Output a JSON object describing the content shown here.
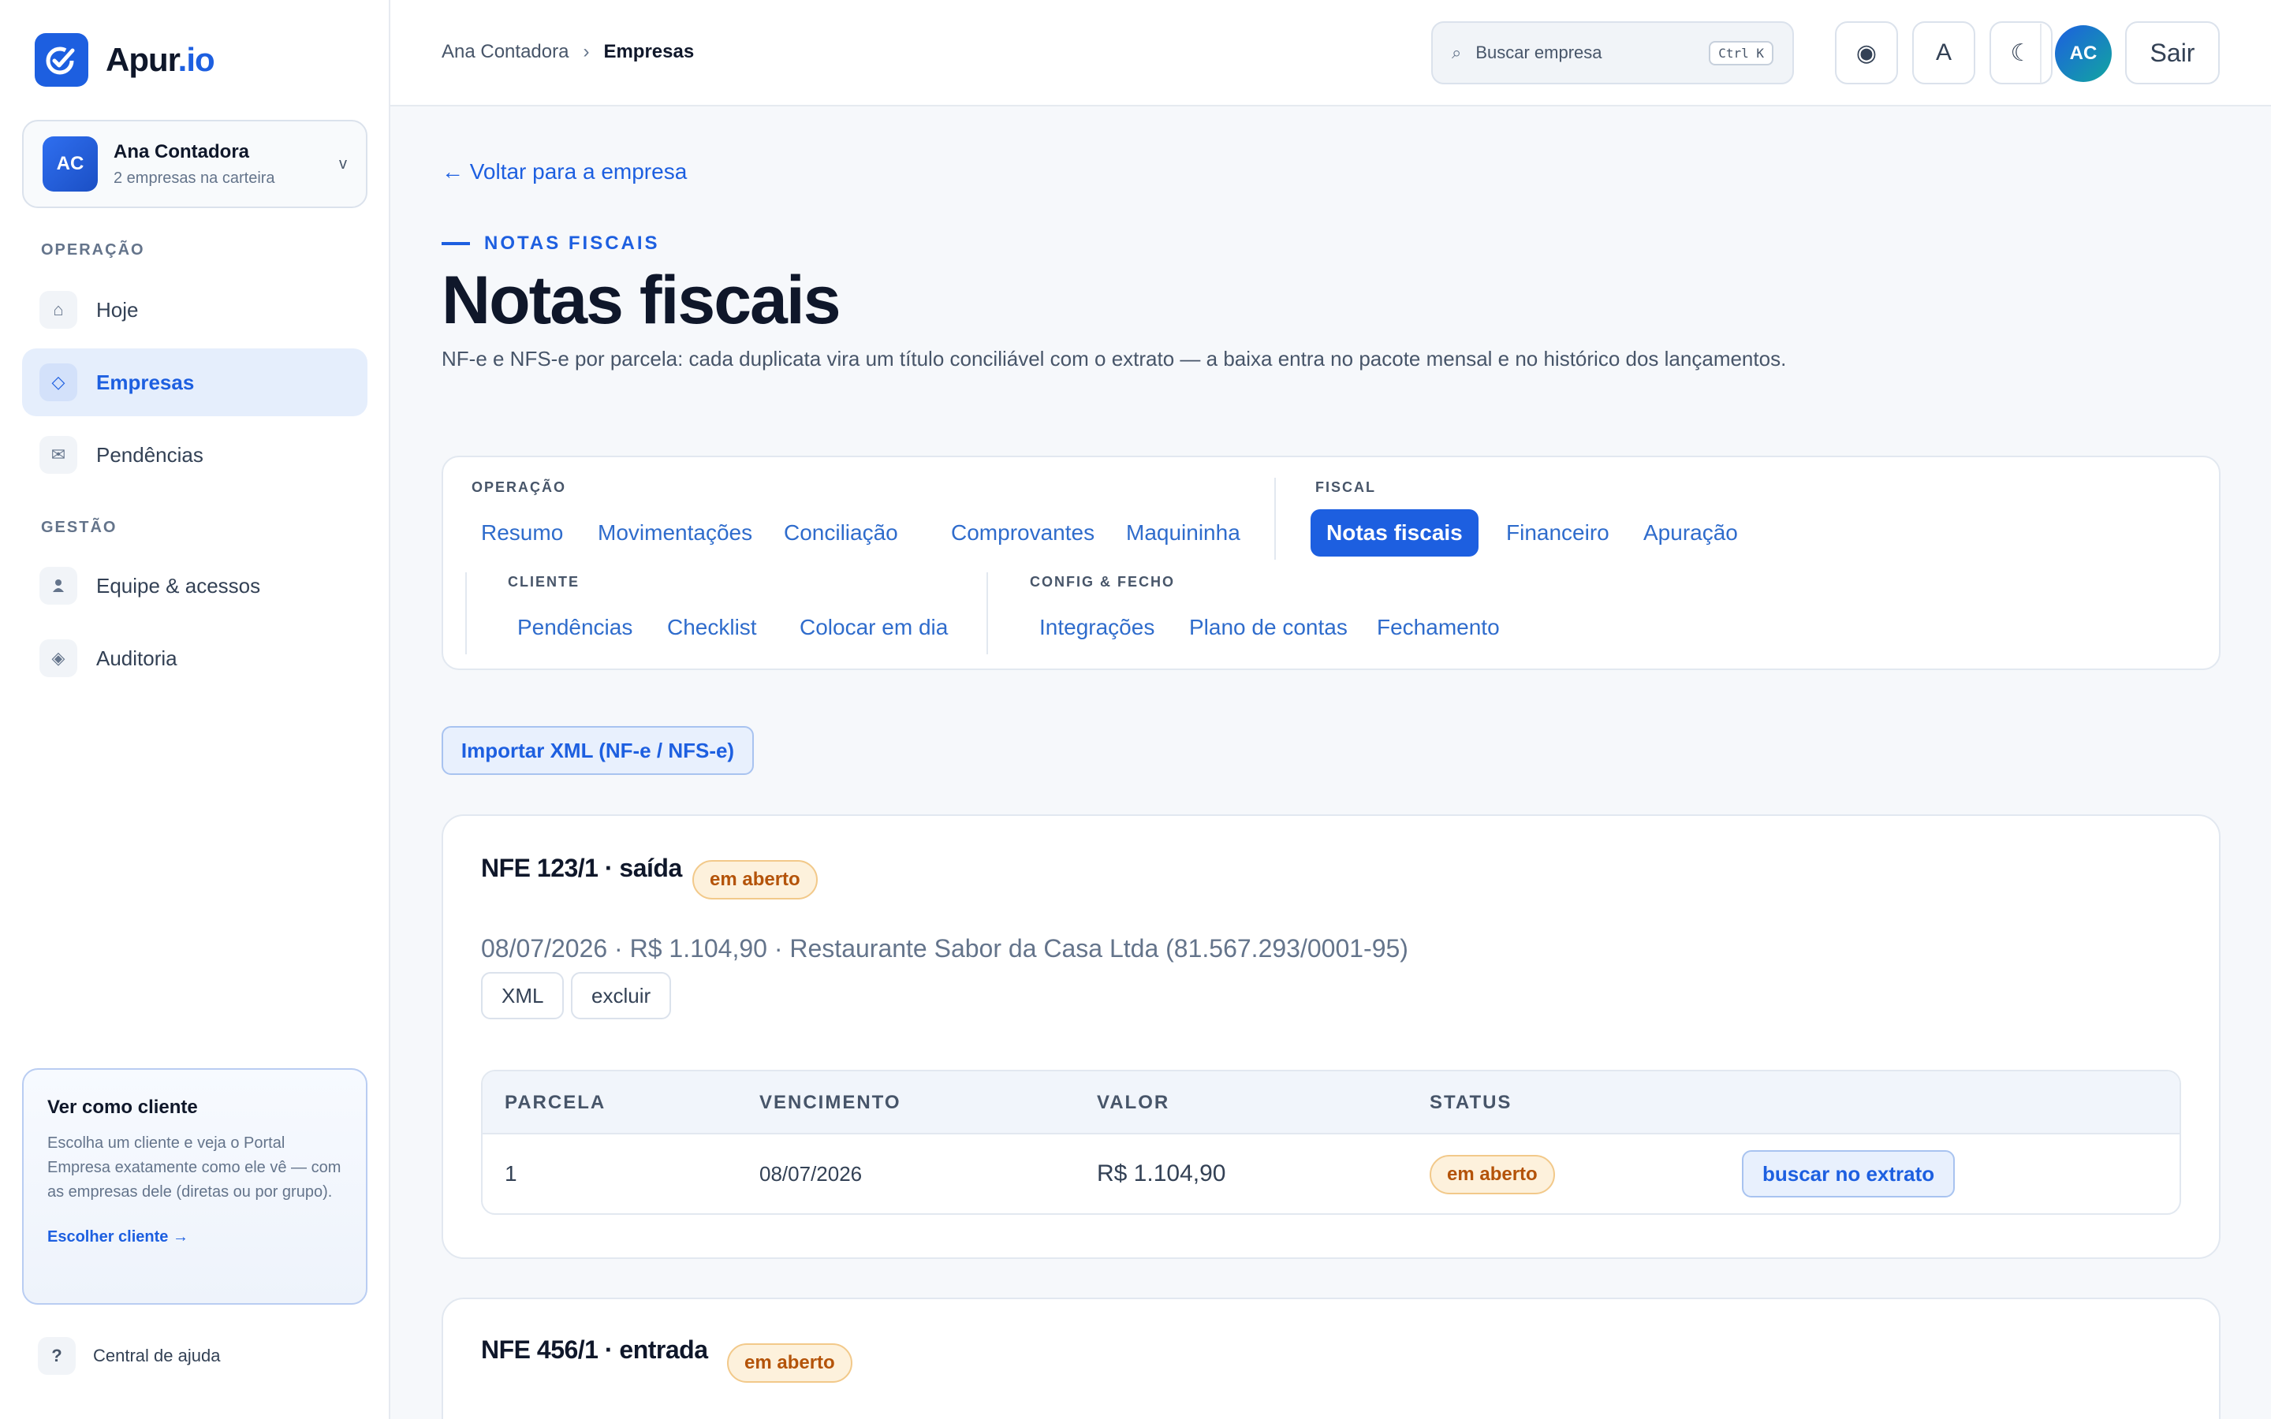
{
  "colors": {
    "accent": "#1d5fe0",
    "badge_open_bg": "#fdf1dc",
    "badge_open_text": "#b45309",
    "page_bg": "#f6f8fb"
  },
  "brand": {
    "name_prefix": "Apur",
    "name_suffix": ".io",
    "icon": "check-circle-icon"
  },
  "account": {
    "initials": "AC",
    "name": "Ana Contadora",
    "subtitle": "2 empresas na carteira",
    "chevron": "v"
  },
  "sidebar": {
    "sections": [
      {
        "label": "OPERAÇÃO"
      },
      {
        "label": "GESTÃO"
      }
    ],
    "items": [
      {
        "label": "Hoje",
        "icon": "home-icon",
        "glyph": "⌂"
      },
      {
        "label": "Empresas",
        "icon": "diamond-icon",
        "glyph": "◇"
      },
      {
        "label": "Pendências",
        "icon": "mail-icon",
        "glyph": "✉"
      },
      {
        "label": "Equipe & acessos",
        "icon": "user-icon",
        "glyph": "👤"
      },
      {
        "label": "Auditoria",
        "icon": "audit-icon",
        "glyph": "◈"
      }
    ]
  },
  "client_view": {
    "title": "Ver como cliente",
    "description": "Escolha um cliente e veja o Portal Empresa exatamente como ele vê — com as empresas dele (diretas ou por grupo).",
    "link": "Escolher cliente →"
  },
  "help": {
    "label": "Central de ajuda",
    "glyph": "?"
  },
  "topbar": {
    "breadcrumb": [
      "Ana Contadora",
      "Empresas"
    ],
    "breadcrumb_sep": "›",
    "search": {
      "placeholder": "Buscar empresa",
      "shortcut": "Ctrl K",
      "glyph": "⌕"
    },
    "buttons": [
      {
        "icon": "record-icon",
        "glyph": "◉"
      },
      {
        "icon": "font-size-icon",
        "glyph": "A"
      },
      {
        "icon": "moon-icon",
        "glyph": "☾"
      }
    ],
    "avatar_initials": "AC",
    "logout_label": "Sair"
  },
  "main": {
    "back_link": "← Voltar para a empresa",
    "eyebrow": "NOTAS FISCAIS",
    "title": "Notas fiscais",
    "description": "NF-e e NFS-e por parcela: cada duplicata vira um título conciliável com o extrato — a baixa entra no pacote mensal e no histórico dos lançamentos.",
    "tab_groups": [
      {
        "label": "OPERAÇÃO",
        "tabs": [
          "Resumo",
          "Movimentações",
          "Conciliação",
          "Comprovantes",
          "Maquininha"
        ]
      },
      {
        "label": "FISCAL",
        "tabs": [
          "Notas fiscais",
          "Financeiro",
          "Apuração"
        ],
        "active": "Notas fiscais"
      },
      {
        "label": "CLIENTE",
        "tabs": [
          "Pendências",
          "Checklist",
          "Colocar em dia"
        ]
      },
      {
        "label": "CONFIG & FECHO",
        "tabs": [
          "Integrações",
          "Plano de contas",
          "Fechamento"
        ]
      }
    ],
    "import_button": "Importar XML (NF-e / NFS-e)"
  },
  "invoices": [
    {
      "title": "NFE 123/1 · saída",
      "status": "em aberto",
      "meta": "08/07/2026 · R$ 1.104,90 · Restaurante Sabor da Casa Ltda (81.567.293/0001-95)",
      "actions": [
        "XML",
        "excluir"
      ],
      "table": {
        "headers": [
          "PARCELA",
          "VENCIMENTO",
          "VALOR",
          "STATUS"
        ],
        "rows": [
          {
            "parcela": "1",
            "vencimento": "08/07/2026",
            "valor": "R$ 1.104,90",
            "status": "em aberto",
            "action": "buscar no extrato"
          }
        ]
      }
    },
    {
      "title": "NFE 456/1 · entrada",
      "status": "em aberto"
    }
  ]
}
